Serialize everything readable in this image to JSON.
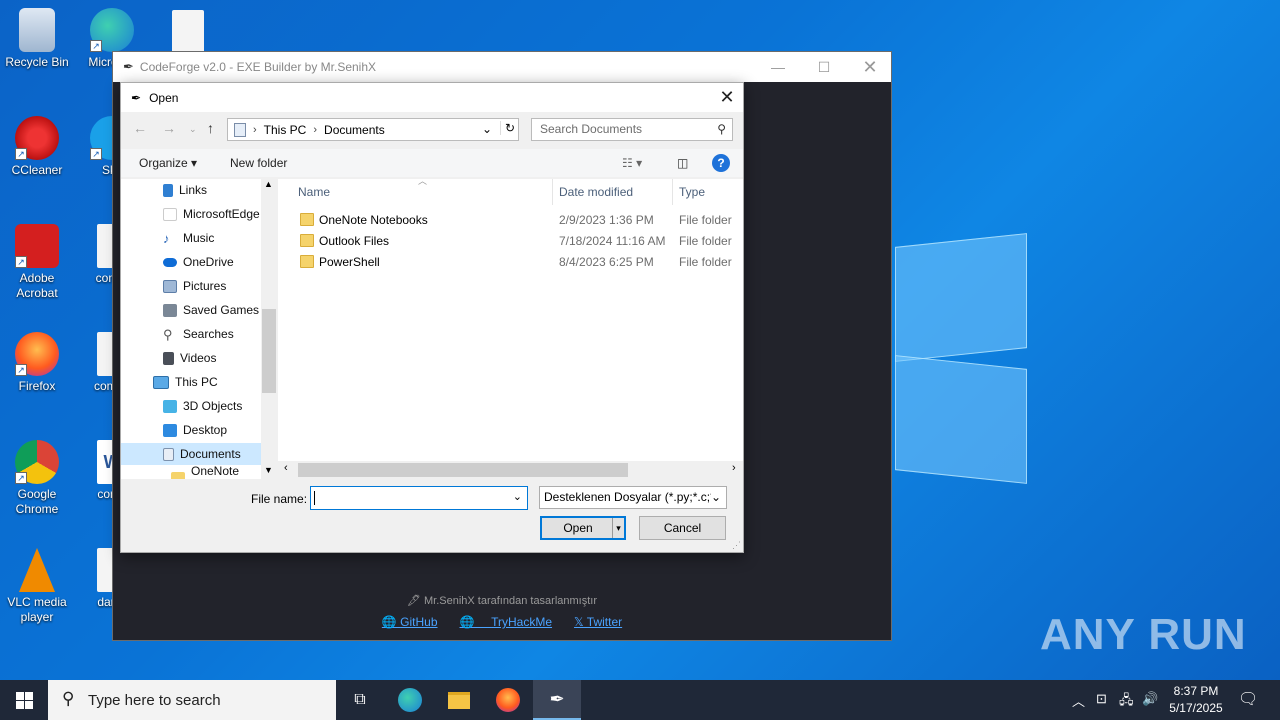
{
  "desktop": {
    "icons": [
      {
        "label": "Recycle Bin"
      },
      {
        "label": "Micro Ed"
      },
      {
        "label": "CCleaner"
      },
      {
        "label": "Sky"
      },
      {
        "label": "Adobe Acrobat"
      },
      {
        "label": "comm"
      },
      {
        "label": "Firefox"
      },
      {
        "label": "compo"
      },
      {
        "label": "Google Chrome"
      },
      {
        "label": "conta"
      },
      {
        "label": "VLC media player"
      },
      {
        "label": "darkk"
      }
    ],
    "watermark": "ANY RUN"
  },
  "app": {
    "title": "CodeForge v2.0 - EXE Builder by Mr.SenihX",
    "footer_credit": "🖋 Mr.SenihX tarafından tasarlanmıştır",
    "links": {
      "github": "GitHub",
      "tryhackme": "TryHackMe",
      "twitter": "𝕏 Twitter"
    }
  },
  "dialog": {
    "title": "Open",
    "address": {
      "root": "This PC",
      "current": "Documents"
    },
    "search_placeholder": "Search Documents",
    "toolbar": {
      "organize": "Organize",
      "new_folder": "New folder"
    },
    "tree": [
      {
        "label": "Links"
      },
      {
        "label": "MicrosoftEdge"
      },
      {
        "label": "Music"
      },
      {
        "label": "OneDrive"
      },
      {
        "label": "Pictures"
      },
      {
        "label": "Saved Games"
      },
      {
        "label": "Searches"
      },
      {
        "label": "Videos"
      },
      {
        "label": "This PC"
      },
      {
        "label": "3D Objects"
      },
      {
        "label": "Desktop"
      },
      {
        "label": "Documents"
      },
      {
        "label": "OneNote Not"
      }
    ],
    "columns": {
      "name": "Name",
      "date": "Date modified",
      "type": "Type"
    },
    "rows": [
      {
        "name": "OneNote Notebooks",
        "date": "2/9/2023 1:36 PM",
        "type": "File folder"
      },
      {
        "name": "Outlook Files",
        "date": "7/18/2024 11:16 AM",
        "type": "File folder"
      },
      {
        "name": "PowerShell",
        "date": "8/4/2023 6:25 PM",
        "type": "File folder"
      }
    ],
    "file_name_label": "File name:",
    "file_name_value": "",
    "file_type": "Desteklenen Dosyalar (*.py;*.c;*",
    "open_label": "Open",
    "cancel_label": "Cancel"
  },
  "taskbar": {
    "search_placeholder": "Type here to search",
    "time": "8:37 PM",
    "date": "5/17/2025"
  }
}
